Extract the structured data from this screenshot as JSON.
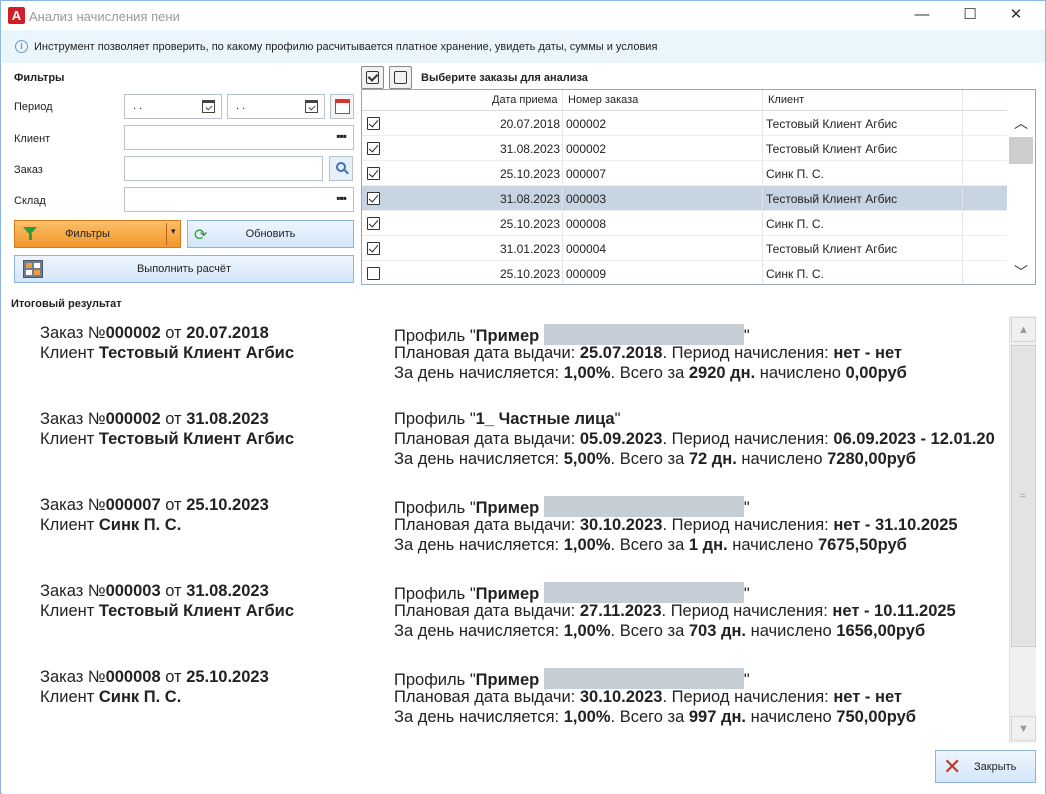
{
  "window": {
    "title": "Анализ начисления пени",
    "app_icon": "А",
    "minimize": "—",
    "maximize": "☐",
    "close": "✕"
  },
  "info": {
    "icon": "i",
    "text": "Инструмент позволяет проверить, по какому профилю расчитывается платное хранение, увидеть даты, суммы и условия"
  },
  "filters": {
    "title": "Фильтры",
    "period_label": "Период",
    "period_from": " .  .",
    "period_to": " .  .",
    "client_label": "Клиент",
    "client_value": "",
    "order_label": "Заказ",
    "order_value": "",
    "warehouse_label": "Склад",
    "warehouse_value": "",
    "dots": "▪▪▪",
    "filters_button": "Фильтры",
    "dropdown_arrow": "▾",
    "refresh_button": "Обновить",
    "calculate_button": "Выполнить расчёт"
  },
  "orders": {
    "title": "Выберите заказы для анализа",
    "columns": [
      "Дата приема",
      "Номер заказа",
      "Клиент"
    ],
    "rows": [
      {
        "checked": true,
        "date": "20.07.2018",
        "number": "000002",
        "client": "Тестовый Клиент Агбис",
        "selected": false
      },
      {
        "checked": true,
        "date": "31.08.2023",
        "number": "000002",
        "client": "Тестовый Клиент Агбис",
        "selected": false
      },
      {
        "checked": true,
        "date": "25.10.2023",
        "number": "000007",
        "client": "Синк П. С.",
        "selected": false
      },
      {
        "checked": true,
        "date": "31.08.2023",
        "number": "000003",
        "client": "Тестовый Клиент Агбис",
        "selected": true
      },
      {
        "checked": true,
        "date": "25.10.2023",
        "number": "000008",
        "client": "Синк П. С.",
        "selected": false
      },
      {
        "checked": true,
        "date": "31.01.2023",
        "number": "000004",
        "client": "Тестовый Клиент Агбис",
        "selected": false
      },
      {
        "checked": false,
        "date": "25.10.2023",
        "number": "000009",
        "client": "Синк П. С.",
        "selected": false
      }
    ],
    "scroll_up": "︿",
    "scroll_down": "﹀"
  },
  "results": {
    "title": "Итоговый результат",
    "label_order": "Заказ №",
    "label_from": " от ",
    "label_client": "Клиент ",
    "label_profile": "Профиль \"",
    "quote_close": "\"",
    "label_plan_date": "Плановая дата выдачи: ",
    "label_period": ". Период начисления: ",
    "label_per_day": "За день начисляется: ",
    "label_total_for": ". Всего за ",
    "label_accrued": " начислено ",
    "items": [
      {
        "order": "000002",
        "date": "20.07.2018",
        "client": "Тестовый Клиент Агбис",
        "profile": "Пример",
        "profile_redacted": true,
        "plan_date": "25.07.2018",
        "period": "нет - нет",
        "rate": "1,00%",
        "days": "2920 дн.",
        "amount": "0,00руб"
      },
      {
        "order": "000002",
        "date": "31.08.2023",
        "client": "Тестовый Клиент Агбис",
        "profile": "1_ Частные лица",
        "profile_redacted": false,
        "plan_date": "05.09.2023",
        "period": "06.09.2023 - 12.01.20",
        "rate": "5,00%",
        "days": "72 дн.",
        "amount": "7280,00руб"
      },
      {
        "order": "000007",
        "date": "25.10.2023",
        "client": "Синк П. С.",
        "profile": "Пример",
        "profile_redacted": true,
        "plan_date": "30.10.2023",
        "period": "нет - 31.10.2025",
        "rate": "1,00%",
        "days": "1 дн.",
        "amount": "7675,50руб"
      },
      {
        "order": "000003",
        "date": "31.08.2023",
        "client": "Тестовый Клиент Агбис",
        "profile": "Пример",
        "profile_redacted": true,
        "plan_date": "27.11.2023",
        "period": "нет - 10.11.2025",
        "rate": "1,00%",
        "days": "703 дн.",
        "amount": "1656,00руб"
      },
      {
        "order": "000008",
        "date": "25.10.2023",
        "client": "Синк П. С.",
        "profile": "Пример",
        "profile_redacted": true,
        "plan_date": "30.10.2023",
        "period": "нет - нет",
        "rate": "1,00%",
        "days": "997 дн.",
        "amount": "750,00руб"
      }
    ],
    "scroll_up": "▲",
    "scroll_down": "▼",
    "grip": "="
  },
  "close_button": "Закрыть",
  "close_icon": "✕"
}
